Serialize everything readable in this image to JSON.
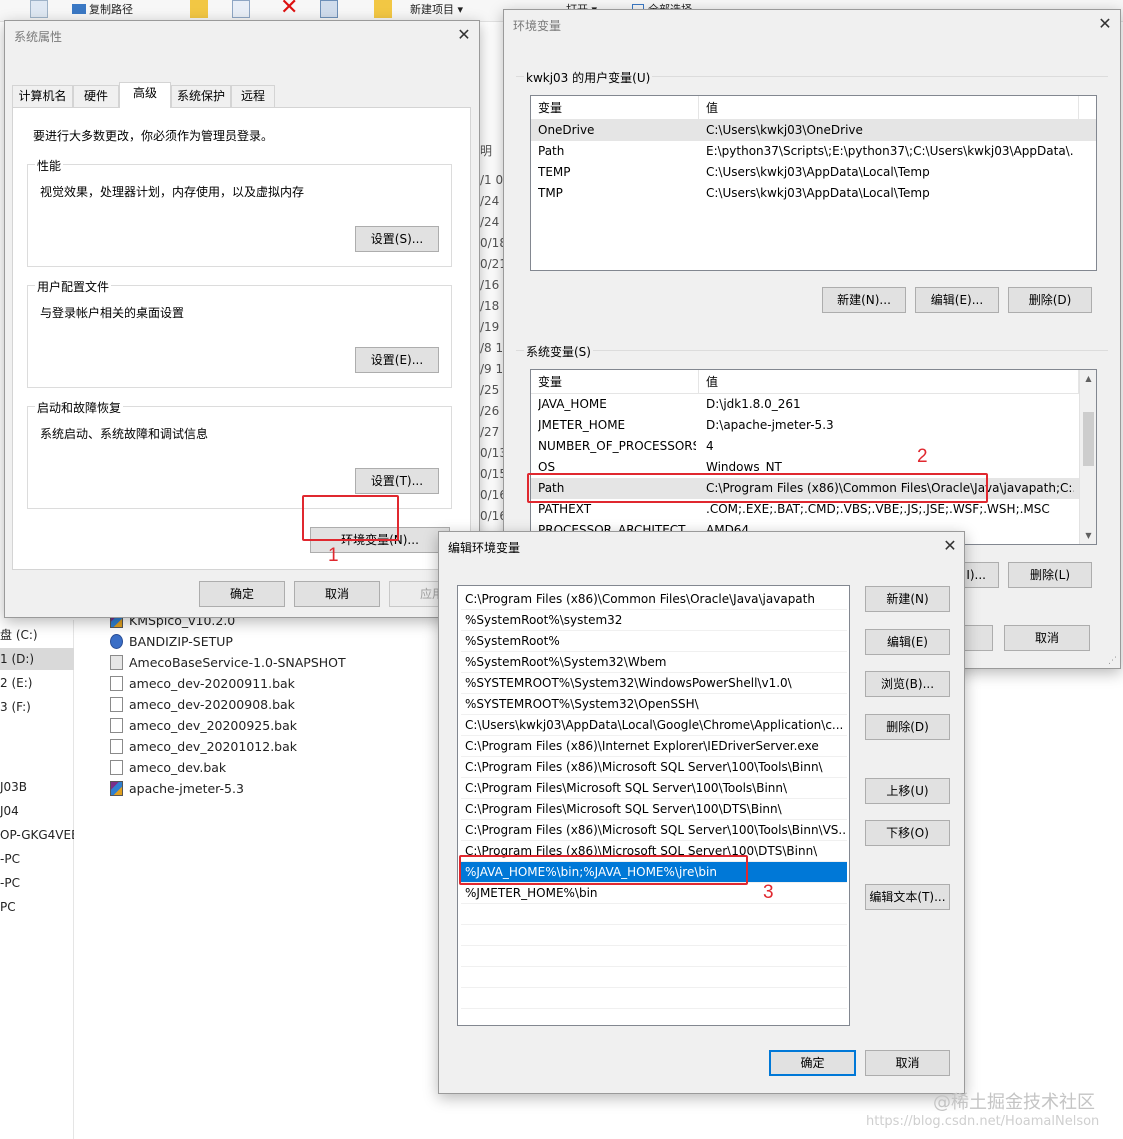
{
  "ribbon": {
    "copy_path": "复制路径",
    "new_item": "新建项目",
    "open": "打开",
    "select_all": "全部选择"
  },
  "explorer": {
    "nav_items": [
      "盘 (C:)",
      "1 (D:)",
      "2 (E:)",
      "3 (F:)",
      "J03B",
      "J04",
      "OP-GKG4VEE",
      "-PC",
      "-PC",
      "PC"
    ],
    "files": [
      {
        "name": "KMSpico_v10.2.0",
        "icon": "zip-icon"
      },
      {
        "name": "BANDIZIP-SETUP",
        "icon": "gear-icon"
      },
      {
        "name": "AmecoBaseService-1.0-SNAPSHOT",
        "icon": "app-icon"
      },
      {
        "name": "ameco_dev-20200911.bak",
        "icon": "file-icon"
      },
      {
        "name": "ameco_dev-20200908.bak",
        "icon": "file-icon"
      },
      {
        "name": "ameco_dev_20200925.bak",
        "icon": "file-icon"
      },
      {
        "name": "ameco_dev_20201012.bak",
        "icon": "file-icon"
      },
      {
        "name": "ameco_dev.bak",
        "icon": "file-icon"
      },
      {
        "name": "apache-jmeter-5.3",
        "icon": "zip-icon"
      }
    ],
    "date_fragments": [
      "明",
      "/1 0",
      "/24",
      "/24",
      "0/18",
      "0/21",
      "/16",
      "/18",
      "/19",
      "/8 1",
      "/9 1",
      "/25",
      "/26",
      "/27",
      "0/13",
      "0/15",
      "0/16",
      "0/16"
    ]
  },
  "sys_props": {
    "title": "系统属性",
    "tabs": [
      "计算机名",
      "硬件",
      "高级",
      "系统保护",
      "远程"
    ],
    "active_tab": "高级",
    "admin_note": "要进行大多数更改，你必须作为管理员登录。",
    "performance": {
      "label": "性能",
      "desc": "视觉效果，处理器计划，内存使用，以及虚拟内存",
      "button": "设置(S)..."
    },
    "profile": {
      "label": "用户配置文件",
      "desc": "与登录帐户相关的桌面设置",
      "button": "设置(E)..."
    },
    "startup": {
      "label": "启动和故障恢复",
      "desc": "系统启动、系统故障和调试信息",
      "button": "设置(T)..."
    },
    "env_button": "环境变量(N)...",
    "ok": "确定",
    "cancel": "取消",
    "apply": "应用"
  },
  "env_vars": {
    "title": "环境变量",
    "user_group": "kwkj03 的用户变量(U)",
    "col_var": "变量",
    "col_val": "值",
    "user_rows": [
      {
        "name": "OneDrive",
        "value": "C:\\Users\\kwkj03\\OneDrive"
      },
      {
        "name": "Path",
        "value": "E:\\python37\\Scripts\\;E:\\python37\\;C:\\Users\\kwkj03\\AppData\\..."
      },
      {
        "name": "TEMP",
        "value": "C:\\Users\\kwkj03\\AppData\\Local\\Temp"
      },
      {
        "name": "TMP",
        "value": "C:\\Users\\kwkj03\\AppData\\Local\\Temp"
      }
    ],
    "user_buttons": {
      "new": "新建(N)...",
      "edit": "编辑(E)...",
      "delete": "删除(D)"
    },
    "sys_group": "系统变量(S)",
    "sys_rows": [
      {
        "name": "JAVA_HOME",
        "value": "D:\\jdk1.8.0_261"
      },
      {
        "name": "JMETER_HOME",
        "value": "D:\\apache-jmeter-5.3"
      },
      {
        "name": "NUMBER_OF_PROCESSORS",
        "value": "4"
      },
      {
        "name": "OS",
        "value": "Windows_NT"
      },
      {
        "name": "Path",
        "value": "C:\\Program Files (x86)\\Common Files\\Oracle\\Java\\javapath;C:..."
      },
      {
        "name": "PATHEXT",
        "value": ".COM;.EXE;.BAT;.CMD;.VBS;.VBE;.JS;.JSE;.WSF;.WSH;.MSC"
      },
      {
        "name": "PROCESSOR_ARCHITECT...",
        "value": "AMD64"
      }
    ],
    "sys_buttons": {
      "edit_partial": "I)...",
      "delete": "删除(L)"
    },
    "cancel": "取消"
  },
  "edit_env": {
    "title": "编辑环境变量",
    "paths": [
      "C:\\Program Files (x86)\\Common Files\\Oracle\\Java\\javapath",
      "%SystemRoot%\\system32",
      "%SystemRoot%",
      "%SystemRoot%\\System32\\Wbem",
      "%SYSTEMROOT%\\System32\\WindowsPowerShell\\v1.0\\",
      "%SYSTEMROOT%\\System32\\OpenSSH\\",
      "C:\\Users\\kwkj03\\AppData\\Local\\Google\\Chrome\\Application\\c...",
      "C:\\Program Files (x86)\\Internet Explorer\\IEDriverServer.exe",
      "C:\\Program Files (x86)\\Microsoft SQL Server\\100\\Tools\\Binn\\",
      "C:\\Program Files\\Microsoft SQL Server\\100\\Tools\\Binn\\",
      "C:\\Program Files\\Microsoft SQL Server\\100\\DTS\\Binn\\",
      "C:\\Program Files (x86)\\Microsoft SQL Server\\100\\Tools\\Binn\\VS...",
      "C:\\Program Files (x86)\\Microsoft SQL Server\\100\\DTS\\Binn\\",
      "%JAVA_HOME%\\bin;%JAVA_HOME%\\jre\\bin",
      "%JMETER_HOME%\\bin"
    ],
    "selected_index": 13,
    "buttons": {
      "new": "新建(N)",
      "edit": "编辑(E)",
      "browse": "浏览(B)...",
      "delete": "删除(D)",
      "up": "上移(U)",
      "down": "下移(O)",
      "edit_text": "编辑文本(T)..."
    },
    "ok": "确定",
    "cancel": "取消"
  },
  "annotations": {
    "n1": "1",
    "n2": "2",
    "n3": "3",
    "color": "#e0282f"
  },
  "watermark": {
    "line1": "@稀土掘金技术社区",
    "line2": "https://blog.csdn.net/HoamalNelson"
  },
  "colors": {
    "selection": "#0078d7",
    "window_bg": "#f0f0f0",
    "button": "#e1e1e1"
  }
}
